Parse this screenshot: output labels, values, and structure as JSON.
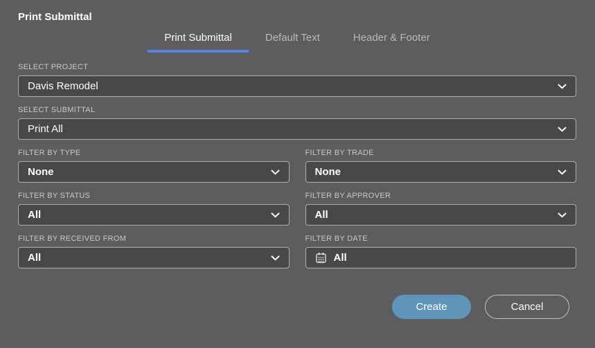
{
  "title": "Print Submittal",
  "tabs": {
    "print_submittal": "Print Submittal",
    "default_text": "Default Text",
    "header_footer": "Header & Footer",
    "active_tab": "Print Submittal"
  },
  "fields": {
    "project": {
      "label": "SELECT PROJECT",
      "value": "Davis Remodel"
    },
    "submittal": {
      "label": "SELECT SUBMITTAL",
      "value": "Print All"
    },
    "type": {
      "label": "FILTER BY TYPE",
      "value": "None"
    },
    "trade": {
      "label": "FILTER BY TRADE",
      "value": "None"
    },
    "status": {
      "label": "FILTER BY STATUS",
      "value": "All"
    },
    "approver": {
      "label": "FILTER BY APPROVER",
      "value": "All"
    },
    "received_from": {
      "label": "FILTER BY RECEIVED FROM",
      "value": "All"
    },
    "date": {
      "label": "FILTER BY DATE",
      "value": "All",
      "icon": "calendar-icon"
    }
  },
  "actions": {
    "create": "Create",
    "cancel": "Cancel"
  },
  "colors": {
    "dialog_bg": "#5d5d5f",
    "field_bg": "#48484a",
    "field_border": "#aeaeae",
    "active_tab_underline": "#5585e0",
    "create_button_bg": "#6095ba",
    "label_text": "#c9c9c9",
    "inactive_tab_text": "#b9b9b9",
    "text": "#ffffff"
  }
}
